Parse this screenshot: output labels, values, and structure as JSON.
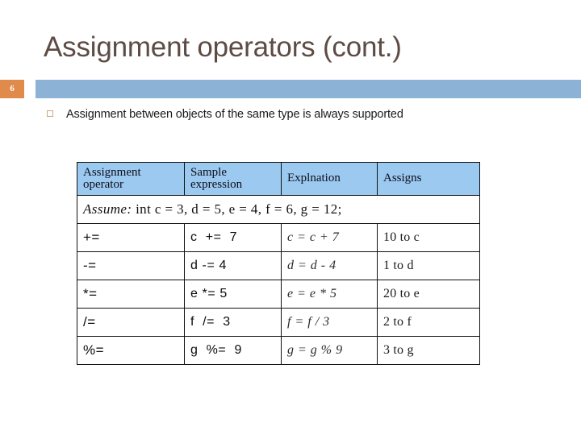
{
  "slide": {
    "title": "Assignment operators (cont.)",
    "number": "6",
    "accent_orange": "#e08a4b",
    "banner_blue": "#8cb2d6",
    "title_color": "#5d4c44",
    "bullet_marker_color": "#c8a882"
  },
  "body": {
    "bullets": [
      "Assignment between objects of the same type is always supported"
    ]
  },
  "table": {
    "header_background": "#9cc9f0",
    "headers": [
      {
        "line1": "Assignment",
        "line2": "operator"
      },
      {
        "line1": "Sample",
        "line2": "expression"
      },
      {
        "line1": "Explnation",
        "line2": ""
      },
      {
        "line1": "Assigns",
        "line2": ""
      }
    ],
    "assume_row": {
      "keyword": "Assume:",
      "statement": "int  c = 3,  d = 5,  e = 4,  f = 6,  g = 12;"
    },
    "rows": [
      {
        "operator": "+=",
        "sample": "c  +=  7",
        "explanation": "c = c + 7",
        "assigns": "10 to c"
      },
      {
        "operator": "-=",
        "sample": "d -= 4",
        "explanation": "d = d - 4",
        "assigns": "1 to d"
      },
      {
        "operator": "*=",
        "sample": "e *= 5",
        "explanation": "e = e * 5",
        "assigns": "20 to e"
      },
      {
        "operator": "/=",
        "sample": "f  /=  3",
        "explanation": "f = f / 3",
        "assigns": "2 to f"
      },
      {
        "operator": "%=",
        "sample": "g  %=  9",
        "explanation": "g = g % 9",
        "assigns": "3 to g"
      }
    ]
  }
}
